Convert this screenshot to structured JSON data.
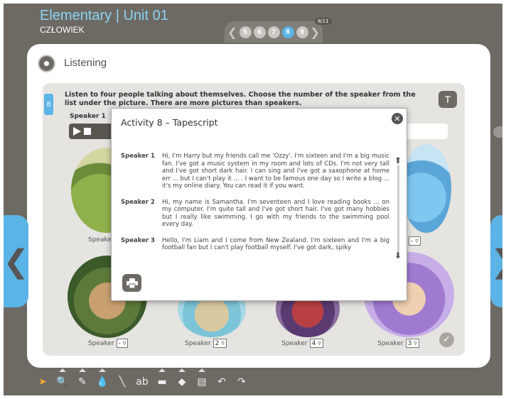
{
  "header": {
    "title": "Elementary | Unit 01",
    "subtitle": "CZŁOWIEK"
  },
  "pager": {
    "pages": [
      "5",
      "6",
      "7",
      "8",
      "9"
    ],
    "active_index": 3,
    "count": "8/11"
  },
  "section": {
    "title": "Listening"
  },
  "activity": {
    "number": "8",
    "instruction": "Listen to four people talking about themselves. Choose the number of the speaker from the list under the picture. There are more pictures than speakers.",
    "t_button": "T",
    "speaker1_label": "Speaker 1"
  },
  "pictures": {
    "top_left_label": "Speake",
    "top_right_value": "-",
    "bottom": [
      {
        "label": "Speaker",
        "value": "-"
      },
      {
        "label": "Speaker",
        "value": "2"
      },
      {
        "label": "Speaker",
        "value": "4"
      },
      {
        "label": "Speaker",
        "value": "3"
      }
    ]
  },
  "modal": {
    "title": "Activity 8 – Tapescript",
    "close_glyph": "✕",
    "entries": [
      {
        "speaker": "Speaker 1",
        "text": "Hi, I'm Harry but my friends call me 'Ozzy'. I'm sixteen and I'm a big music fan. I've got a music system in my room and lots of CDs. I'm not very tall and I've got short dark hair. I can sing and I've got a saxophone at home err ... but I can't play it ... . I want to be famous one day so I write a blog ... it's my online diary. You can read it if you want."
      },
      {
        "speaker": "Speaker 2",
        "text": "Hi, my name is Samantha. I'm seventeen and I love reading books ... on my computer. I'm quite tall and I've got short hair. I've got many hobbies but I really like swimming. I go with my friends to the swimming pool every day."
      },
      {
        "speaker": "Speaker 3",
        "text": "Hello, I'm Liam and I come from New Zealand. I'm sixteen and I'm a big football fan but I can't play football myself. I've got dark, spiky"
      }
    ]
  },
  "nav": {
    "prev": "❮",
    "next": "❯",
    "check": "✓"
  },
  "toolbar": {
    "tools": [
      {
        "icon": "pointer-icon",
        "glyph": "➤"
      },
      {
        "icon": "zoom-icon",
        "glyph": "🔍"
      },
      {
        "icon": "pen-icon",
        "glyph": "✎"
      },
      {
        "icon": "ink-drop-icon",
        "glyph": "💧"
      },
      {
        "icon": "line-icon",
        "glyph": "╲"
      },
      {
        "icon": "text-tool-icon",
        "glyph": "ab"
      },
      {
        "icon": "rectangle-icon",
        "glyph": "▬"
      },
      {
        "icon": "eraser-icon",
        "glyph": "◆"
      },
      {
        "icon": "notes-icon",
        "glyph": "▤"
      },
      {
        "icon": "undo-icon",
        "glyph": "↶"
      },
      {
        "icon": "redo-icon",
        "glyph": "↷"
      }
    ]
  },
  "colors": {
    "accent": "#5bb4e6",
    "background": "#6d6a64",
    "panel": "#e5e4e0"
  }
}
